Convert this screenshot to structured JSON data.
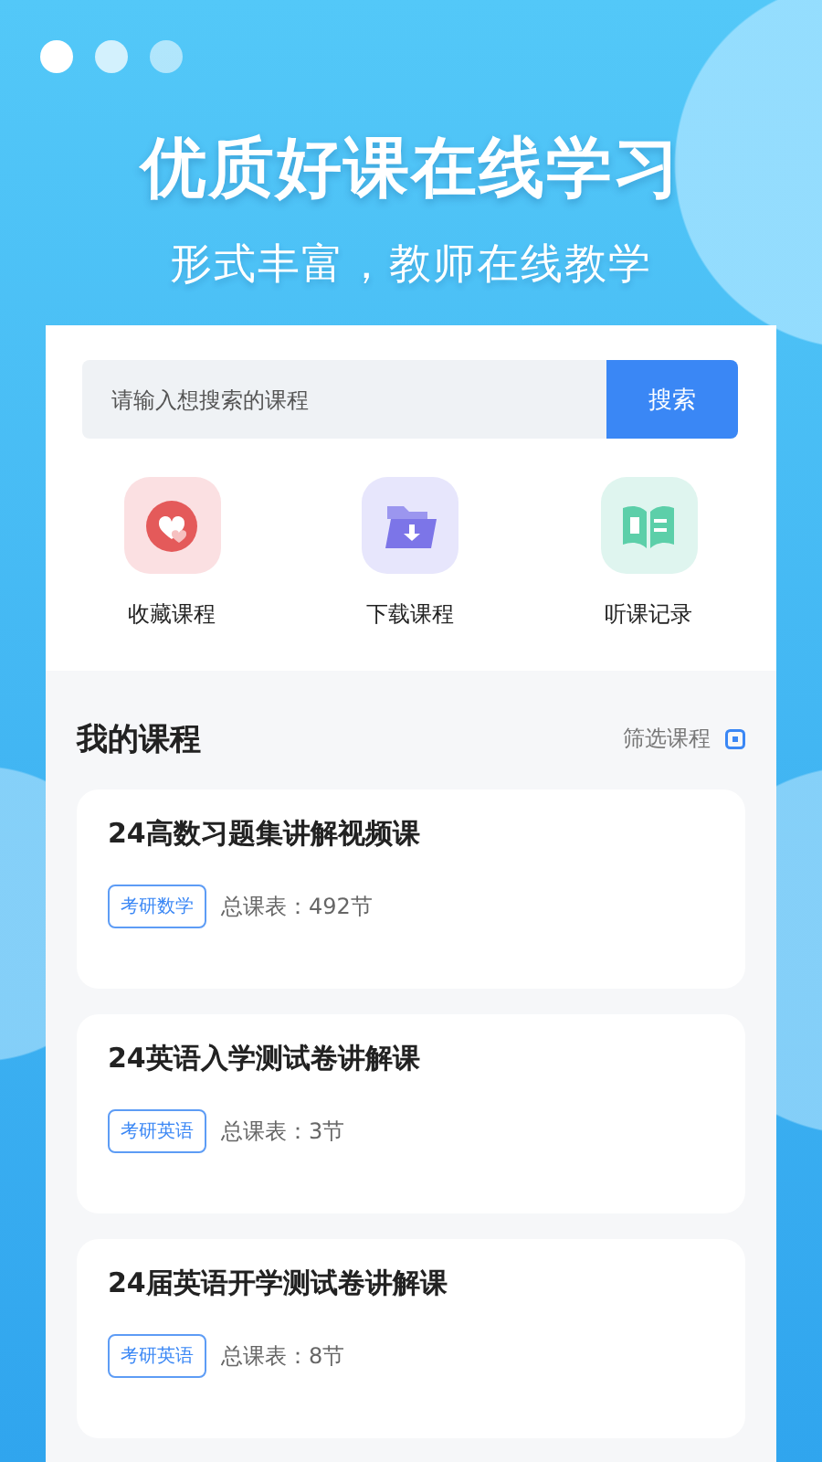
{
  "headline": "优质好课在线学习",
  "subheadline": "形式丰富，教师在线教学",
  "search": {
    "placeholder": "请输入想搜索的课程",
    "button": "搜索"
  },
  "shortcuts": [
    {
      "kind": "heart",
      "label": "收藏课程"
    },
    {
      "kind": "folder",
      "label": "下载课程"
    },
    {
      "kind": "book",
      "label": "听课记录"
    }
  ],
  "section": {
    "title": "我的课程",
    "filter": "筛选课程"
  },
  "courses": [
    {
      "title": "24高数习题集讲解视频课",
      "tag": "考研数学",
      "lessons": "总课表：492节"
    },
    {
      "title": "24英语入学测试卷讲解课",
      "tag": "考研英语",
      "lessons": "总课表：3节"
    },
    {
      "title": "24届英语开学测试卷讲解课",
      "tag": "考研英语",
      "lessons": "总课表：8节"
    }
  ]
}
